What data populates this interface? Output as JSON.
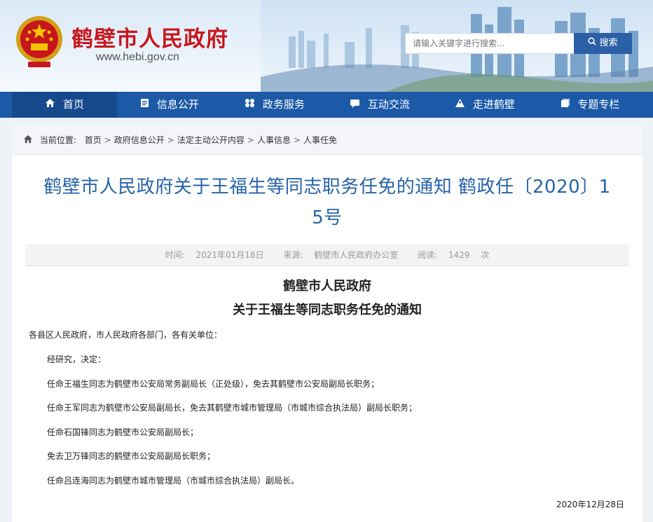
{
  "header": {
    "site_name": "鹤壁市人民政府",
    "site_url": "www.hebi.gov.cn",
    "search_placeholder": "请输入关键字进行搜索...",
    "search_button": "搜索"
  },
  "nav": {
    "items": [
      {
        "label": "首页",
        "icon": "home-icon"
      },
      {
        "label": "信息公开",
        "icon": "document-icon"
      },
      {
        "label": "政务服务",
        "icon": "service-icon"
      },
      {
        "label": "互动交流",
        "icon": "chat-icon"
      },
      {
        "label": "走进鹤壁",
        "icon": "mountain-icon"
      },
      {
        "label": "专题专栏",
        "icon": "folder-icon"
      }
    ]
  },
  "breadcrumb": {
    "prefix": "当前位置:",
    "items": [
      "首页",
      "政府信息公开",
      "法定主动公开内容",
      "人事信息",
      "人事任免"
    ]
  },
  "article": {
    "title_line1": "鹤壁市人民政府关于王福生等同志职务任免的通知 鹤政任〔2020〕1",
    "title_line2": "5号",
    "meta": {
      "time_label": "时间:",
      "time": "2021年01月18日",
      "source_label": "来源:",
      "source": "鹤壁市人民政府办公室",
      "views_label": "阅读:",
      "views": "1429",
      "views_unit": "次"
    },
    "doc_head_1": "鹤壁市人民政府",
    "doc_head_2": "关于王福生等同志职务任免的通知",
    "addressee": "各县区人民政府，市人民政府各部门，各有关单位：",
    "paragraphs": [
      "经研究，决定：",
      "任命王福生同志为鹤壁市公安局常务副局长（正处级），免去其鹤壁市公安局副局长职务；",
      "任命王军同志为鹤壁市公安局副局长，免去其鹤壁市城市管理局（市城市综合执法局）副局长职务；",
      "任命石国锋同志为鹤壁市公安局副局长；",
      "免去卫万锋同志的鹤壁市公安局副局长职务；",
      "任命吕连海同志为鹤壁市城市管理局（市城市综合执法局）副局长。"
    ],
    "date": "2020年12月28日"
  },
  "colors": {
    "brand_red": "#c8161d",
    "nav_blue": "#1c5aa8",
    "title_blue": "#2763a8"
  }
}
